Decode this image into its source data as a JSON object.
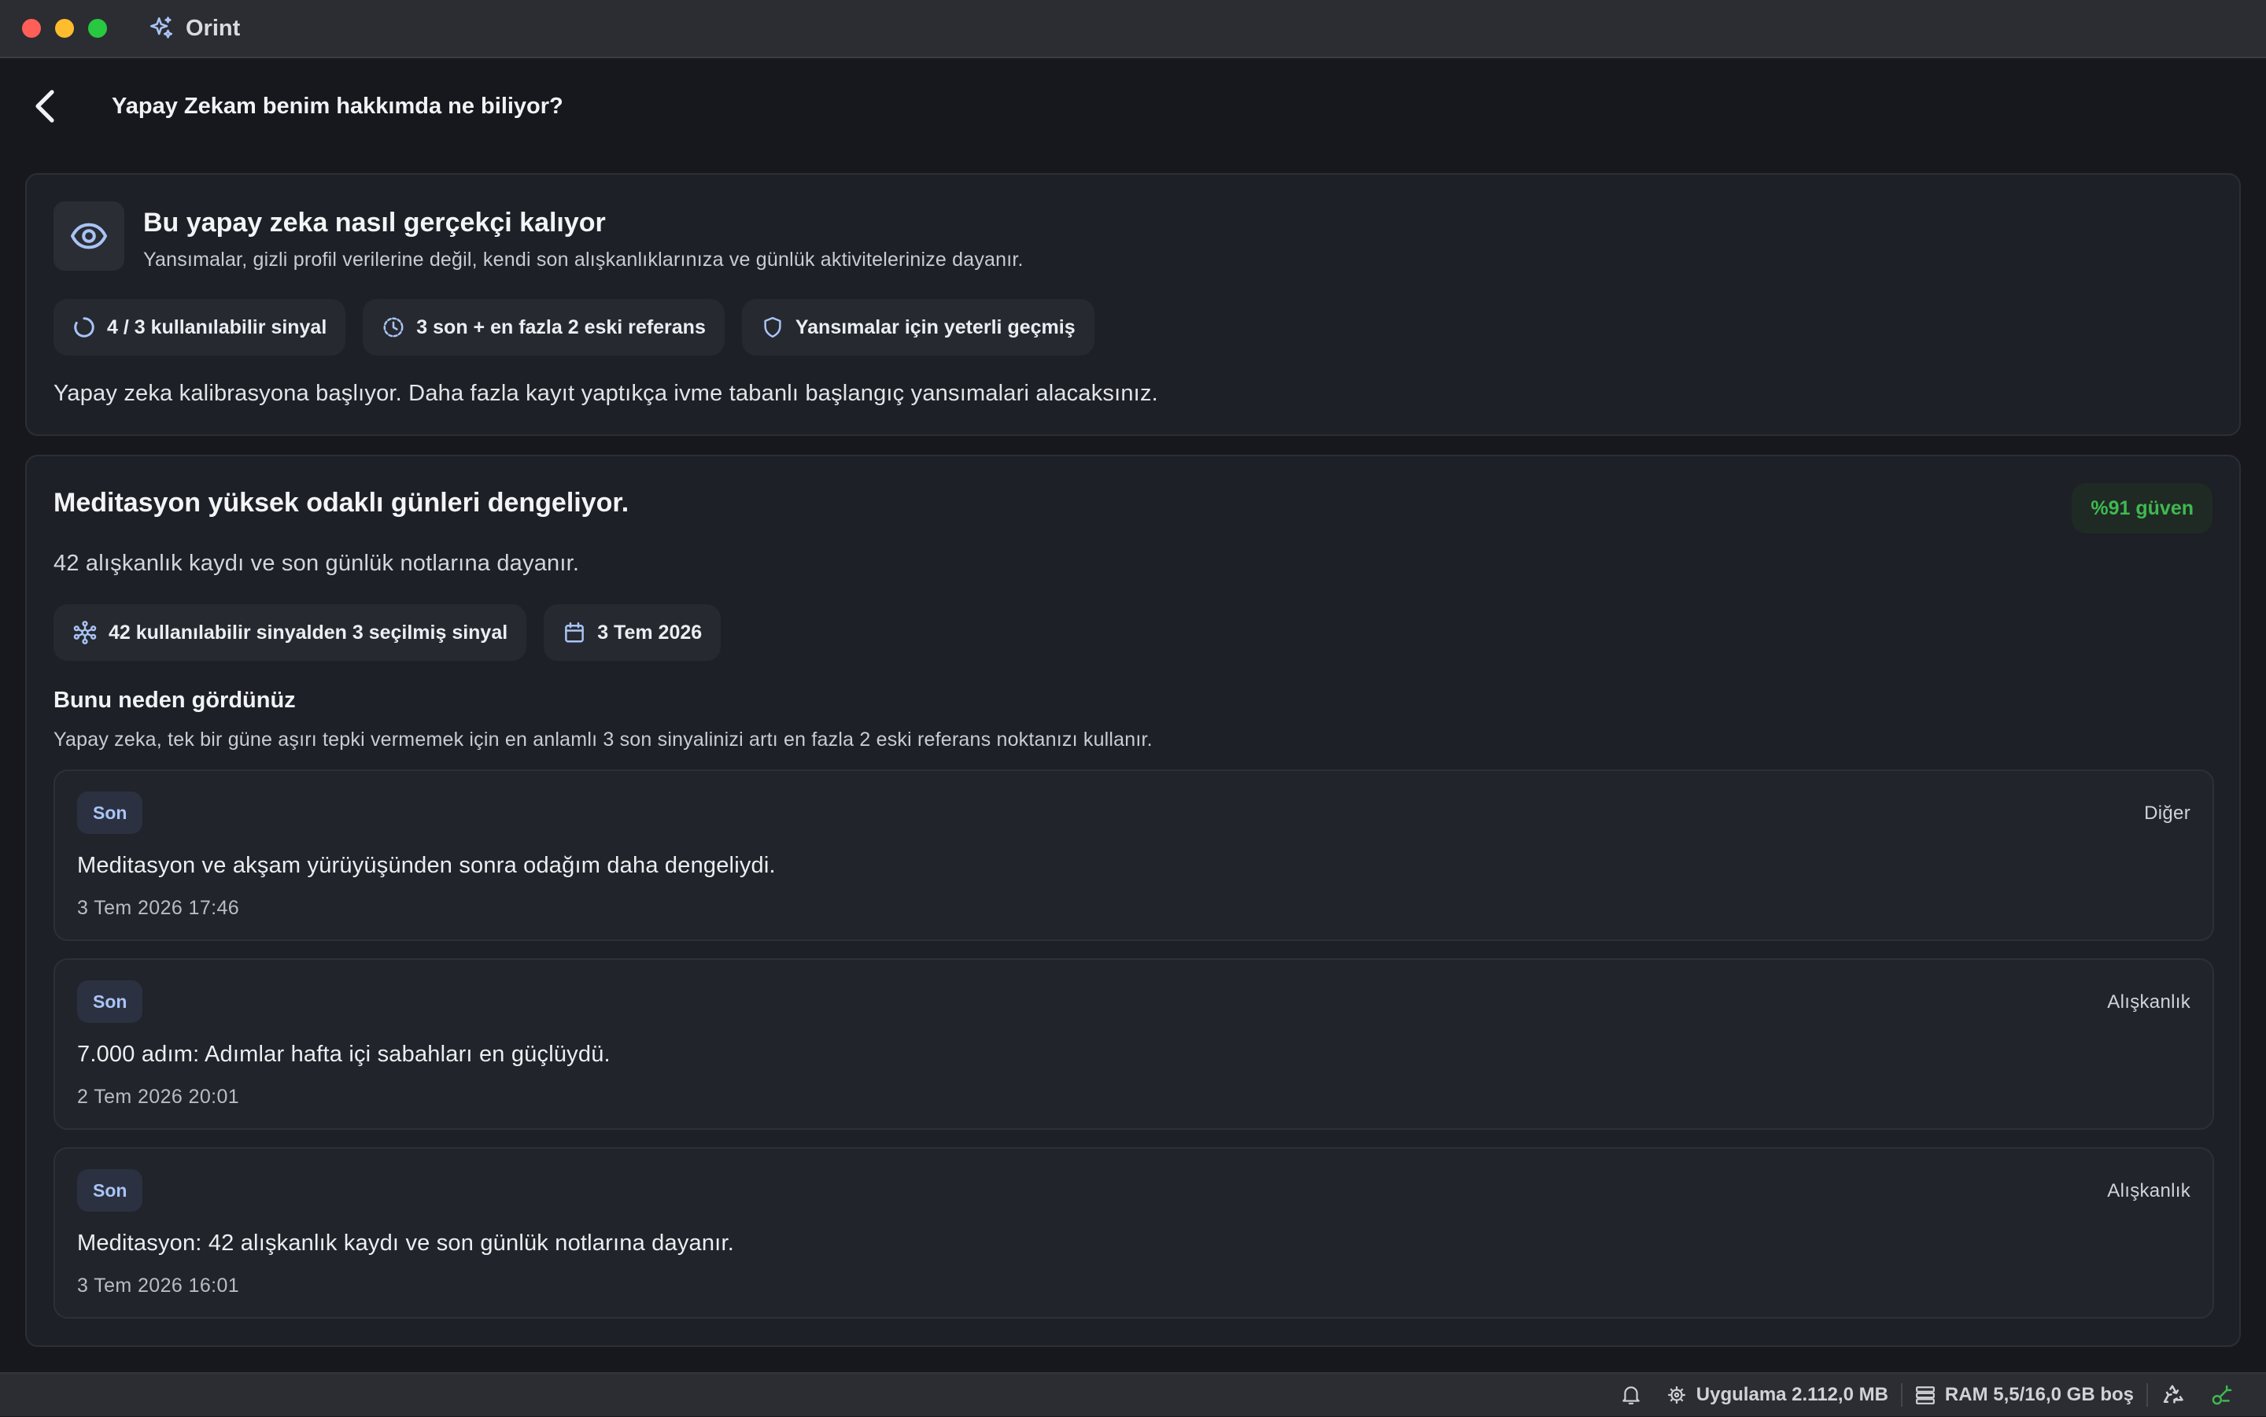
{
  "window": {
    "app_name": "Orint"
  },
  "header": {
    "title": "Yapay Zekam benim hakkımda ne biliyor?"
  },
  "info_card": {
    "title": "Bu yapay zeka nasıl gerçekçi kalıyor",
    "subtitle": "Yansımalar, gizli profil verilerine değil, kendi son alışkanlıklarınıza ve günlük aktivitelerinize dayanır.",
    "chips": [
      {
        "label": "4 / 3 kullanılabilir sinyal",
        "icon": "progress-ring-icon"
      },
      {
        "label": "3 son + en fazla 2 eski referans",
        "icon": "history-clock-icon"
      },
      {
        "label": "Yansımalar için yeterli geçmiş",
        "icon": "shield-icon"
      }
    ],
    "note": "Yapay zeka kalibrasyona başlıyor. Daha fazla kayıt yaptıkça ivme tabanlı başlangıç yansımalari alacaksınız."
  },
  "insight_card": {
    "title": "Meditasyon yüksek odaklı günleri dengeliyor.",
    "confidence": "%91 güven",
    "subtitle": "42 alışkanlık kaydı ve son günlük notlarına dayanır.",
    "chips": [
      {
        "label": "42 kullanılabilir sinyalden 3 seçilmiş sinyal",
        "icon": "network-nodes-icon"
      },
      {
        "label": "3 Tem 2026",
        "icon": "calendar-icon"
      }
    ],
    "why_title": "Bunu neden gördünüz",
    "why_subtitle": "Yapay zeka, tek bir güne aşırı tepki vermemek için en anlamlı 3 son sinyalinizi artı en fazla 2 eski referans noktanızı kullanır.",
    "signals": [
      {
        "badge": "Son",
        "category": "Diğer",
        "text": "Meditasyon ve akşam yürüyüşünden sonra odağım daha dengeliydi.",
        "date": "3 Tem 2026 17:46"
      },
      {
        "badge": "Son",
        "category": "Alışkanlık",
        "text": "7.000 adım: Adımlar hafta içi sabahları en güçlüydü.",
        "date": "2 Tem 2026 20:01"
      },
      {
        "badge": "Son",
        "category": "Alışkanlık",
        "text": "Meditasyon: 42 alışkanlık kaydı ve son günlük notlarına dayanır.",
        "date": "3 Tem 2026 16:01"
      }
    ]
  },
  "statusbar": {
    "app_memory": "Uygulama 2.112,0 MB",
    "ram": "RAM 5,5/16,0 GB boş"
  },
  "colors": {
    "accent": "#a9c4f5",
    "confidence": "#3fb950",
    "background": "#16181d",
    "card": "#1d2026"
  }
}
